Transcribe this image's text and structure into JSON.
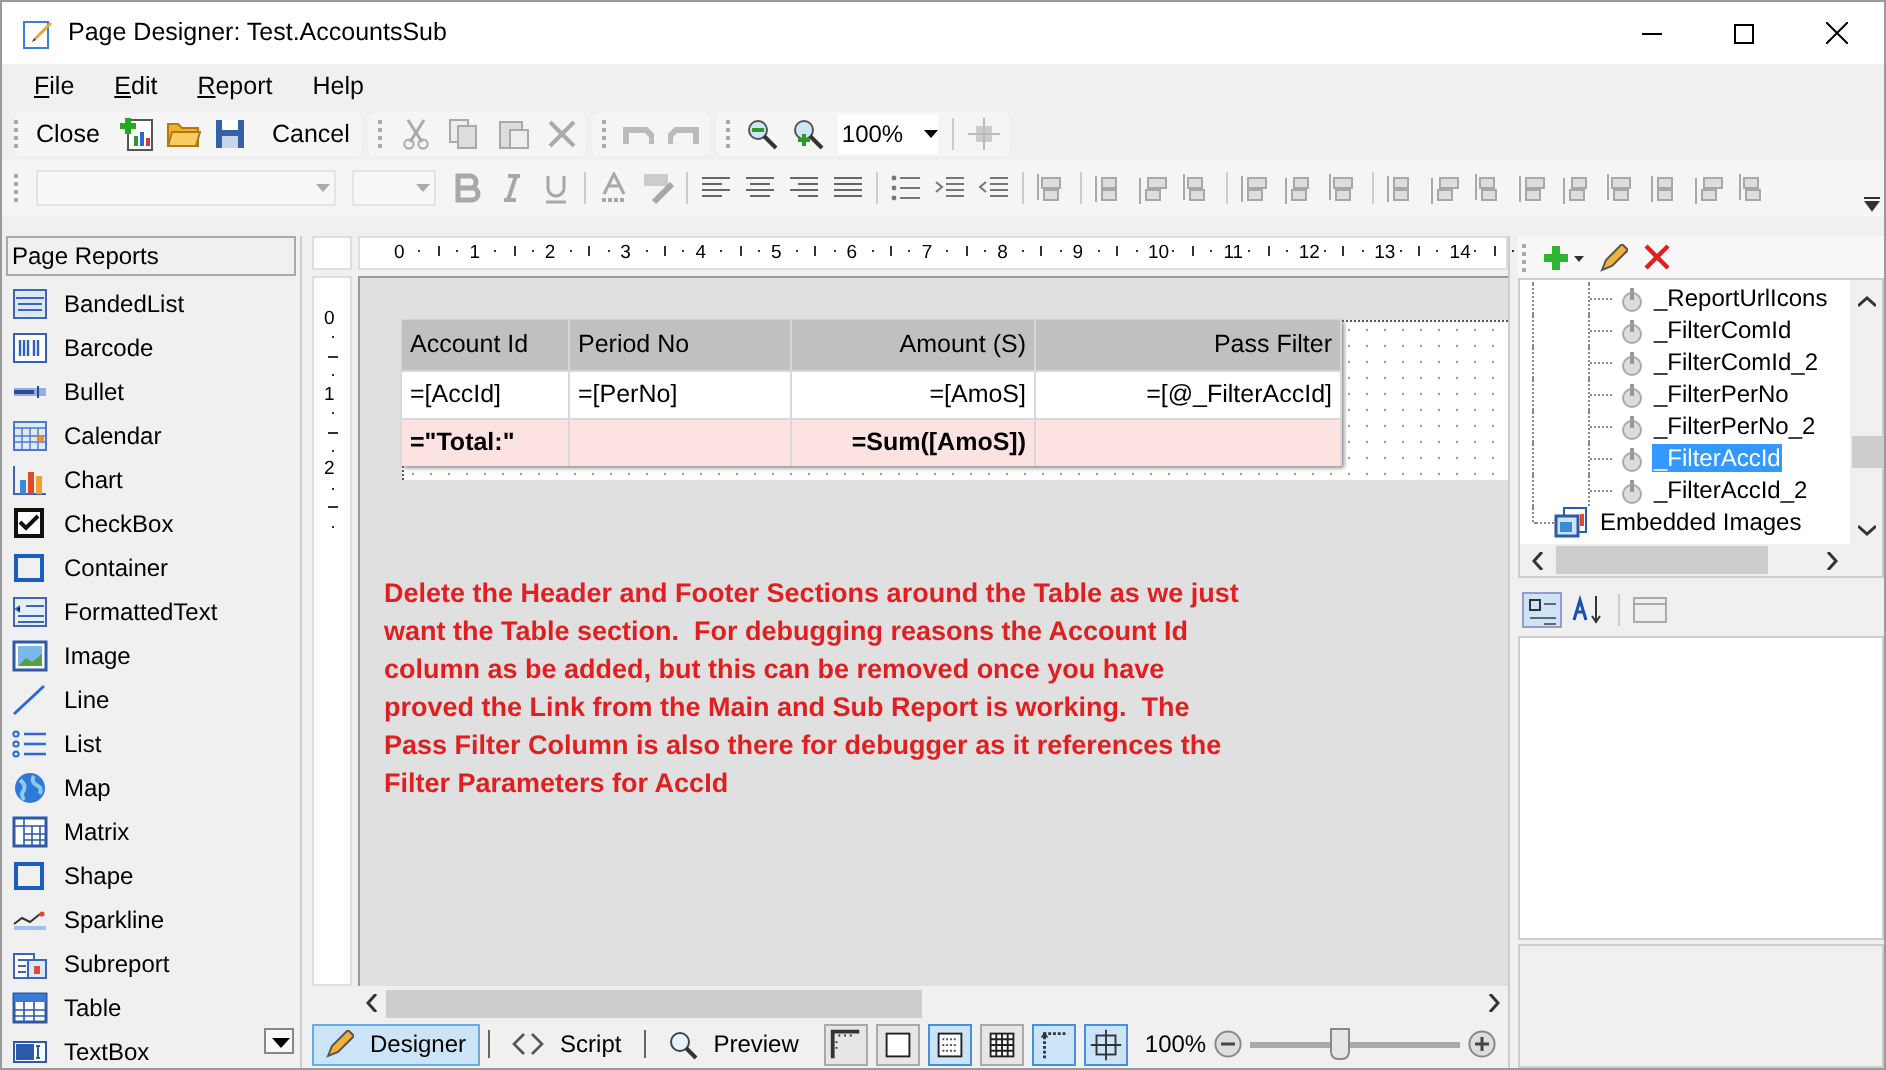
{
  "window": {
    "title": "Page Designer: Test.AccountsSub"
  },
  "menu": [
    {
      "label": "File",
      "mnemonic": true
    },
    {
      "label": "Edit",
      "mnemonic": true
    },
    {
      "label": "Report",
      "mnemonic": true
    },
    {
      "label": "Help",
      "mnemonic": false
    }
  ],
  "toolbar": {
    "close": "Close",
    "cancel": "Cancel",
    "zoom": "100%"
  },
  "toolbox": {
    "title": "Page Reports",
    "items": [
      {
        "label": "BandedList"
      },
      {
        "label": "Barcode"
      },
      {
        "label": "Bullet"
      },
      {
        "label": "Calendar"
      },
      {
        "label": "Chart"
      },
      {
        "label": "CheckBox"
      },
      {
        "label": "Container"
      },
      {
        "label": "FormattedText"
      },
      {
        "label": "Image"
      },
      {
        "label": "Line"
      },
      {
        "label": "List"
      },
      {
        "label": "Map"
      },
      {
        "label": "Matrix"
      },
      {
        "label": "Shape"
      },
      {
        "label": "Sparkline"
      },
      {
        "label": "Subreport"
      },
      {
        "label": "Table"
      },
      {
        "label": "TextBox"
      }
    ]
  },
  "ruler": {
    "horizontal": [
      "0",
      "1",
      "2",
      "3",
      "4",
      "5",
      "6",
      "7",
      "8",
      "9",
      "10",
      "11",
      "12",
      "13",
      "14"
    ],
    "vertical": [
      "0",
      "1",
      "2"
    ]
  },
  "report_table": {
    "columns": [
      {
        "header": "Account Id",
        "kind": "text"
      },
      {
        "header": "Period No",
        "kind": "text"
      },
      {
        "header": "Amount (S)",
        "kind": "number"
      },
      {
        "header": "Pass Filter",
        "kind": "number"
      }
    ],
    "rows": [
      {
        "kind": "detail",
        "cells": [
          "=[AccId]",
          "=[PerNo]",
          "=[AmoS]",
          "=[@_FilterAccId]"
        ]
      },
      {
        "kind": "footer",
        "cells": [
          "=\"Total:\"",
          null,
          "=Sum([AmoS])",
          null
        ]
      }
    ]
  },
  "note": "Delete the Header and Footer Sections around the Table as we just want the Table section.  For debugging reasons the Account Id column as be added, but this can be removed once you have proved the Link from the Main and Sub Report is working.  The Pass Filter Column is also there for debugger as it references the Filter Parameters for AccId",
  "view_tabs": [
    {
      "label": "Designer",
      "selected": true
    },
    {
      "label": "Script",
      "selected": false
    },
    {
      "label": "Preview",
      "selected": false
    }
  ],
  "view_toggles": [
    {
      "on": false
    },
    {
      "on": false
    },
    {
      "on": true
    },
    {
      "on": false
    },
    {
      "on": true
    },
    {
      "on": true
    }
  ],
  "zoom": {
    "reading": "100%",
    "level": 0.42
  },
  "tree": [
    {
      "kind": "parameter",
      "label": "_ReportUrlIcons",
      "selected": false
    },
    {
      "kind": "parameter",
      "label": "_FilterComId",
      "selected": false
    },
    {
      "kind": "parameter",
      "label": "_FilterComId_2",
      "selected": false
    },
    {
      "kind": "parameter",
      "label": "_FilterPerNo",
      "selected": false
    },
    {
      "kind": "parameter",
      "label": "_FilterPerNo_2",
      "selected": false
    },
    {
      "kind": "parameter",
      "label": "_FilterAccId",
      "selected": true
    },
    {
      "kind": "parameter",
      "label": "_FilterAccId_2",
      "selected": false
    },
    {
      "kind": "folder",
      "label": "Embedded Images",
      "selected": false
    }
  ]
}
